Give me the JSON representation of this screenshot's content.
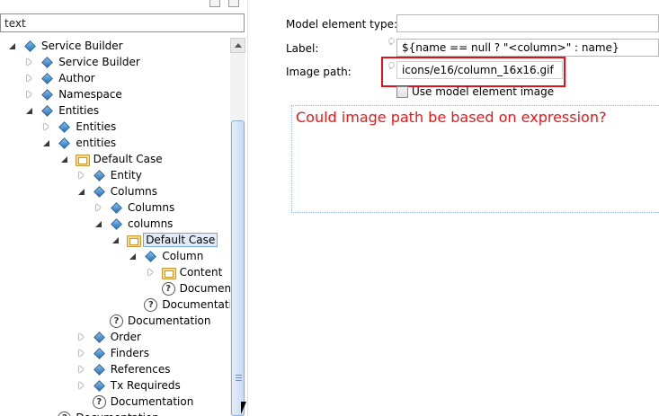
{
  "left_pane": {
    "filter_text": "text",
    "tree": [
      {
        "label": "Service Builder",
        "indent": 0,
        "state": "expanded",
        "icon": "diamond-icon"
      },
      {
        "label": "Service Builder",
        "indent": 1,
        "state": "collapsed",
        "icon": "diamond-icon"
      },
      {
        "label": "Author",
        "indent": 1,
        "state": "collapsed",
        "icon": "diamond-icon"
      },
      {
        "label": "Namespace",
        "indent": 1,
        "state": "collapsed",
        "icon": "diamond-icon"
      },
      {
        "label": "Entities",
        "indent": 1,
        "state": "expanded",
        "icon": "diamond-icon"
      },
      {
        "label": "Entities",
        "indent": 2,
        "state": "collapsed",
        "icon": "diamond-icon"
      },
      {
        "label": "entities",
        "indent": 2,
        "state": "expanded",
        "icon": "diamond-icon"
      },
      {
        "label": "Default Case",
        "indent": 3,
        "state": "expanded",
        "icon": "folder-icon"
      },
      {
        "label": "Entity",
        "indent": 4,
        "state": "collapsed",
        "icon": "diamond-icon"
      },
      {
        "label": "Columns",
        "indent": 4,
        "state": "expanded",
        "icon": "diamond-icon"
      },
      {
        "label": "Columns",
        "indent": 5,
        "state": "collapsed",
        "icon": "diamond-icon"
      },
      {
        "label": "columns",
        "indent": 5,
        "state": "expanded",
        "icon": "diamond-icon"
      },
      {
        "label": "Default Case",
        "indent": 6,
        "state": "expanded",
        "icon": "folder-icon",
        "selected": true
      },
      {
        "label": "Column",
        "indent": 7,
        "state": "expanded",
        "icon": "diamond-icon"
      },
      {
        "label": "Content",
        "indent": 8,
        "state": "collapsed",
        "icon": "folder-icon"
      },
      {
        "label": "Documentation",
        "indent": 8,
        "state": "none",
        "icon": "help-icon"
      },
      {
        "label": "Documentation",
        "indent": 7,
        "state": "none",
        "icon": "help-icon"
      },
      {
        "label": "Documentation",
        "indent": 5,
        "state": "none",
        "icon": "help-icon"
      },
      {
        "label": "Order",
        "indent": 4,
        "state": "collapsed",
        "icon": "diamond-icon"
      },
      {
        "label": "Finders",
        "indent": 4,
        "state": "collapsed",
        "icon": "diamond-icon"
      },
      {
        "label": "References",
        "indent": 4,
        "state": "collapsed",
        "icon": "diamond-icon"
      },
      {
        "label": "Tx Requireds",
        "indent": 4,
        "state": "collapsed",
        "icon": "diamond-icon"
      },
      {
        "label": "Documentation",
        "indent": 4,
        "state": "none",
        "icon": "help-icon"
      },
      {
        "label": "Documentation",
        "indent": 2,
        "state": "none",
        "icon": "help-icon"
      }
    ]
  },
  "right_pane": {
    "model_element_type_label": "Model element type:",
    "model_element_type_value": "",
    "label_label": "Label:",
    "label_value": "${name == null ? \"<column>\" : name}",
    "image_path_label": "Image path:",
    "image_path_value": "icons/e16/column_16x16.gif",
    "use_model_image_label": "Use model element image",
    "use_model_image_checked": false,
    "annotation_text": "Could image path be based on expression?",
    "annotation_color": "#e51a1a",
    "highlight_color": "#e2101a"
  }
}
